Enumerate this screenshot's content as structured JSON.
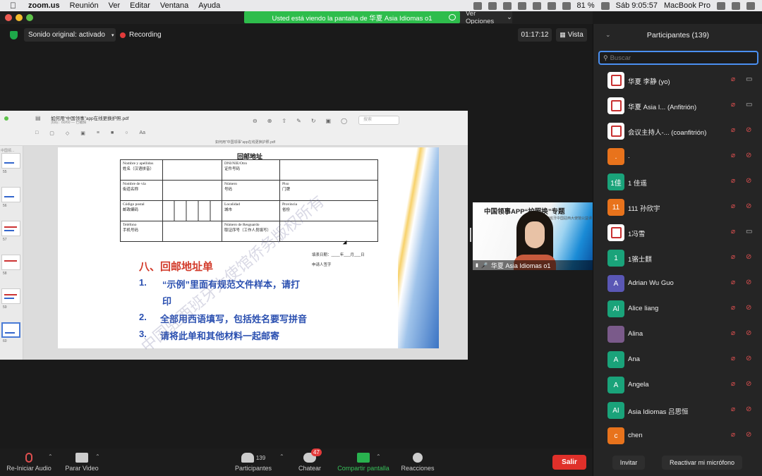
{
  "menubar": {
    "app": "zoom.us",
    "items": [
      "Reunión",
      "Ver",
      "Editar",
      "Ventana",
      "Ayuda"
    ],
    "battery": "81 %",
    "clock": "Sáb 9:05:57",
    "device": "MacBook Pro"
  },
  "banner": {
    "text": "Usted está viendo la pantalla de 华夏 Asia Idiomas o1",
    "view_options": "Ver Opciones"
  },
  "top": {
    "audio": "Sonido original: activado",
    "recording": "Recording",
    "timer": "01:17:12",
    "view": "Vista"
  },
  "pdf": {
    "filename": "如何用“中国领事”app在线更换护照.pdf",
    "subtitle": "页码：60/60 — 已编辑",
    "center_name": "如何用“中国领事”app在线更换护照.pdf",
    "search_placeholder": "搜索",
    "thumb_label": "中国领...",
    "thumb_numbers": [
      "55",
      "56",
      "57",
      "58",
      "59",
      "60"
    ],
    "form_title": "回邮地址",
    "form_rows": [
      [
        "Nombre y apellidos\n姓名（汉语拼音）",
        "",
        "DNI/NIE/Otro\n证件号码",
        ""
      ],
      [
        "Nombre de vía\n街道名称",
        "",
        "Número\n号码",
        "Piso\n门牌"
      ],
      [
        "Código postal\n邮政编码",
        "",
        "Localidad\n城市",
        "Provincia\n省份"
      ],
      [
        "Teléfono\n手机号码",
        "",
        "Número de Resguardo\n取证序号（工作人员填写）",
        ""
      ]
    ],
    "sign_date": "填表日期：____年___月___日",
    "sign_name": "申请人签字",
    "heading": "八、回邮地址单",
    "items": [
      {
        "num": "1.",
        "text": "“示例”里面有规范文件样本，请打"
      },
      {
        "num": "",
        "text": "印"
      },
      {
        "num": "2.",
        "text": "全部用西语填写，包括姓名要写拼音"
      },
      {
        "num": "3.",
        "text": "请将此单和其他材料一起邮寄"
      }
    ],
    "watermark": "中国驻西班牙大使馆侨务版权所有"
  },
  "video": {
    "title": "中国领事APP“护照换”专题",
    "subtitle": "西班牙中国驻西大使馆公益课",
    "name": "华夏 Asia Idiomas o1"
  },
  "toolbar": {
    "audio": "Re-Iniciar Audio",
    "video": "Parar Video",
    "participants": "Participantes",
    "participants_count": "139",
    "chat": "Chatear",
    "chat_badge": "47",
    "share": "Compartir pantalla",
    "reactions": "Reacciones",
    "leave": "Salir"
  },
  "panel": {
    "title": "Participantes (139)",
    "search_placeholder": "Buscar",
    "participants": [
      {
        "initial": "",
        "color": "logo",
        "name": "华夏 李静 (yo)",
        "cam": "on"
      },
      {
        "initial": "",
        "color": "logo",
        "name": "华夏 Asia I... (Anfitrión)",
        "cam": "on"
      },
      {
        "initial": "",
        "color": "logo",
        "name": "会议主持人-... (coanfitrión)",
        "cam": "off"
      },
      {
        "initial": ".",
        "color": "#e8731c",
        "name": ".",
        "cam": "off"
      },
      {
        "initial": "1佳",
        "color": "#1aa37a",
        "name": "1 佳遥",
        "cam": "off"
      },
      {
        "initial": "11",
        "color": "#e8731c",
        "name": "111 孙欣宇",
        "cam": "off"
      },
      {
        "initial": "",
        "color": "logo",
        "name": "1冯雪",
        "cam": "on"
      },
      {
        "initial": "1",
        "color": "#1aa37a",
        "name": "1骆士麒",
        "cam": "off"
      },
      {
        "initial": "A",
        "color": "#5a57b5",
        "name": "Adrian Wu Guo",
        "cam": "off"
      },
      {
        "initial": "Al",
        "color": "#1aa37a",
        "name": "Alice liang",
        "cam": "off"
      },
      {
        "initial": "",
        "color": "#7a5a8a",
        "name": "Alina",
        "cam": "off"
      },
      {
        "initial": "A",
        "color": "#1aa37a",
        "name": "Ana",
        "cam": "off"
      },
      {
        "initial": "A",
        "color": "#1aa37a",
        "name": "Angela",
        "cam": "off"
      },
      {
        "initial": "AI",
        "color": "#1aa37a",
        "name": "Asia Idiomas 吕思恒",
        "cam": "off"
      },
      {
        "initial": "c",
        "color": "#e8731c",
        "name": "chen",
        "cam": "off"
      }
    ],
    "invite": "Invitar",
    "unmute": "Reactivar mi micrófono"
  }
}
